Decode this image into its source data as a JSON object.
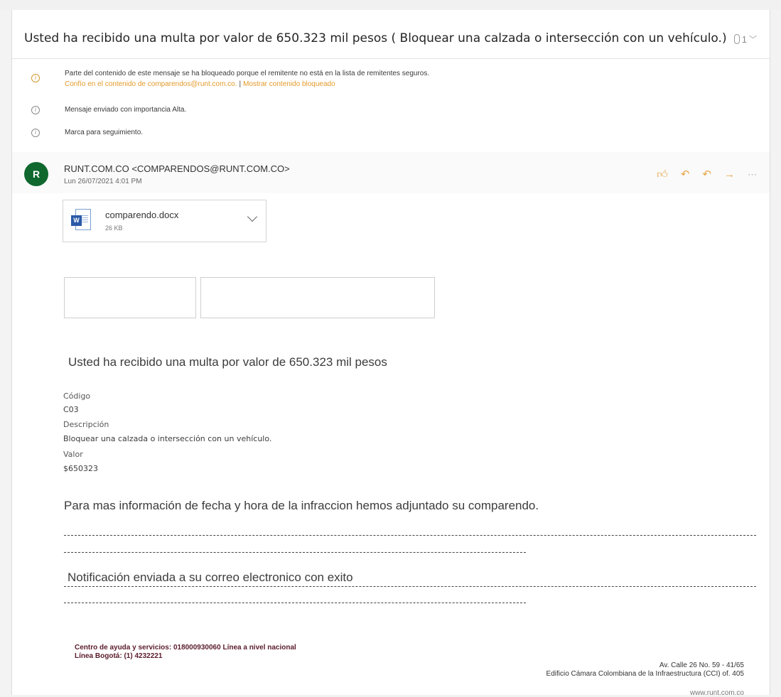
{
  "subject": {
    "title": "Usted ha recibido una multa por valor de 650.323 mil pesos ( Bloquear una calzada o intersección con un vehículo.)",
    "attachment_count": "1"
  },
  "notices": {
    "blocked_text": "Parte del contenido de este mensaje se ha bloqueado porque el remitente no está en la lista de remitentes seguros.",
    "trust_link": "Confío en el contenido de comparendos@runt.com.co.",
    "separator": "|",
    "show_blocked_link": "Mostrar contenido bloqueado",
    "importance": "Mensaje enviado con importancia Alta.",
    "followup": "Marca para seguimiento."
  },
  "sender": {
    "avatar_letter": "R",
    "name": "RUNT.COM.CO <COMPARENDOS@RUNT.COM.CO>",
    "date": "Lun 26/07/2021 4:01 PM"
  },
  "actions": {
    "like_icon": "thumbs-up-icon",
    "reply_icon": "reply-icon",
    "reply_all_icon": "reply-all-icon",
    "forward_icon": "forward-icon",
    "more_icon": "more-icon"
  },
  "attachment": {
    "name": "comparendo.docx",
    "size": "26 KB",
    "icon": "word-file-icon",
    "badge": "W"
  },
  "body": {
    "lead": "Usted  ha recibido una multa por valor de  650.323 mil pesos",
    "code_label": "Código",
    "code_value": "C03",
    "desc_label": "Descripción",
    "desc_value": "Bloquear una calzada o intersección con un vehículo.",
    "value_label": "Valor",
    "value_value": "$650323",
    "info": "Para mas información de fecha y hora de la infraccion hemos adjuntado su comparendo.",
    "notification": "Notificación enviada a su correo electronico con exito"
  },
  "footer": {
    "help_line1": "Centro de ayuda y servicios: 018000930060 Línea a nivel nacional",
    "help_line2": "Línea Bogotá: (1) 4232221",
    "address1": "Av. Calle 26 No. 59 - 41/65",
    "address2": "Edificio Cámara Colombiana de la Infraestructura (CCI) of. 405",
    "url": "www.runt.com.co"
  },
  "colors": {
    "avatar": "#10682f",
    "link_warning": "#e29a2a",
    "footer_text": "#5a1c2b"
  }
}
